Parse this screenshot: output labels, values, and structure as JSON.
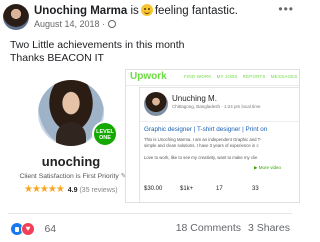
{
  "post": {
    "author": "Unoching Marma",
    "feeling_prefix": "is",
    "feeling": "feeling fantastic.",
    "emoji": "grinning-face-icon",
    "date": "August 14, 2018",
    "text_line1": "Two Little achievements in this month",
    "text_line2": "Thanks BEACON IT"
  },
  "profile_card": {
    "badge_line1": "LEVEL",
    "badge_line2": "ONE",
    "name": "unoching",
    "tagline": "Client Satisfaction is First Priority",
    "stars": "★★★★★",
    "rating": "4.9",
    "reviews": "(35 reviews)"
  },
  "upwork": {
    "logo": "Upwork",
    "nav": [
      "FIND WORK",
      "MY JOBS",
      "REPORTS",
      "MESSAGES"
    ],
    "name": "Unuching M.",
    "location": "Chittagong, Bangladesh · 1:24 pm local time",
    "title": "Graphic designer | T-shirt designer | Print on",
    "desc_line1": "This is Unoching Marma. I am an independent Graphic and T-",
    "desc_line2": "simple and clean solutions. I have 3 years of experience in c",
    "desc_line3": "Love to work, like to see my creativity, want to make my clie",
    "more": "More video",
    "stats": [
      "$30.00",
      "$1k+",
      "17",
      "33"
    ]
  },
  "footer": {
    "reaction_count": "64",
    "comments": "18 Comments",
    "shares": "3 Shares"
  },
  "colors": {
    "upwork_green": "#6fda44",
    "level_badge": "#14a800",
    "like_blue": "#1877f2",
    "love_red": "#f33e58"
  }
}
